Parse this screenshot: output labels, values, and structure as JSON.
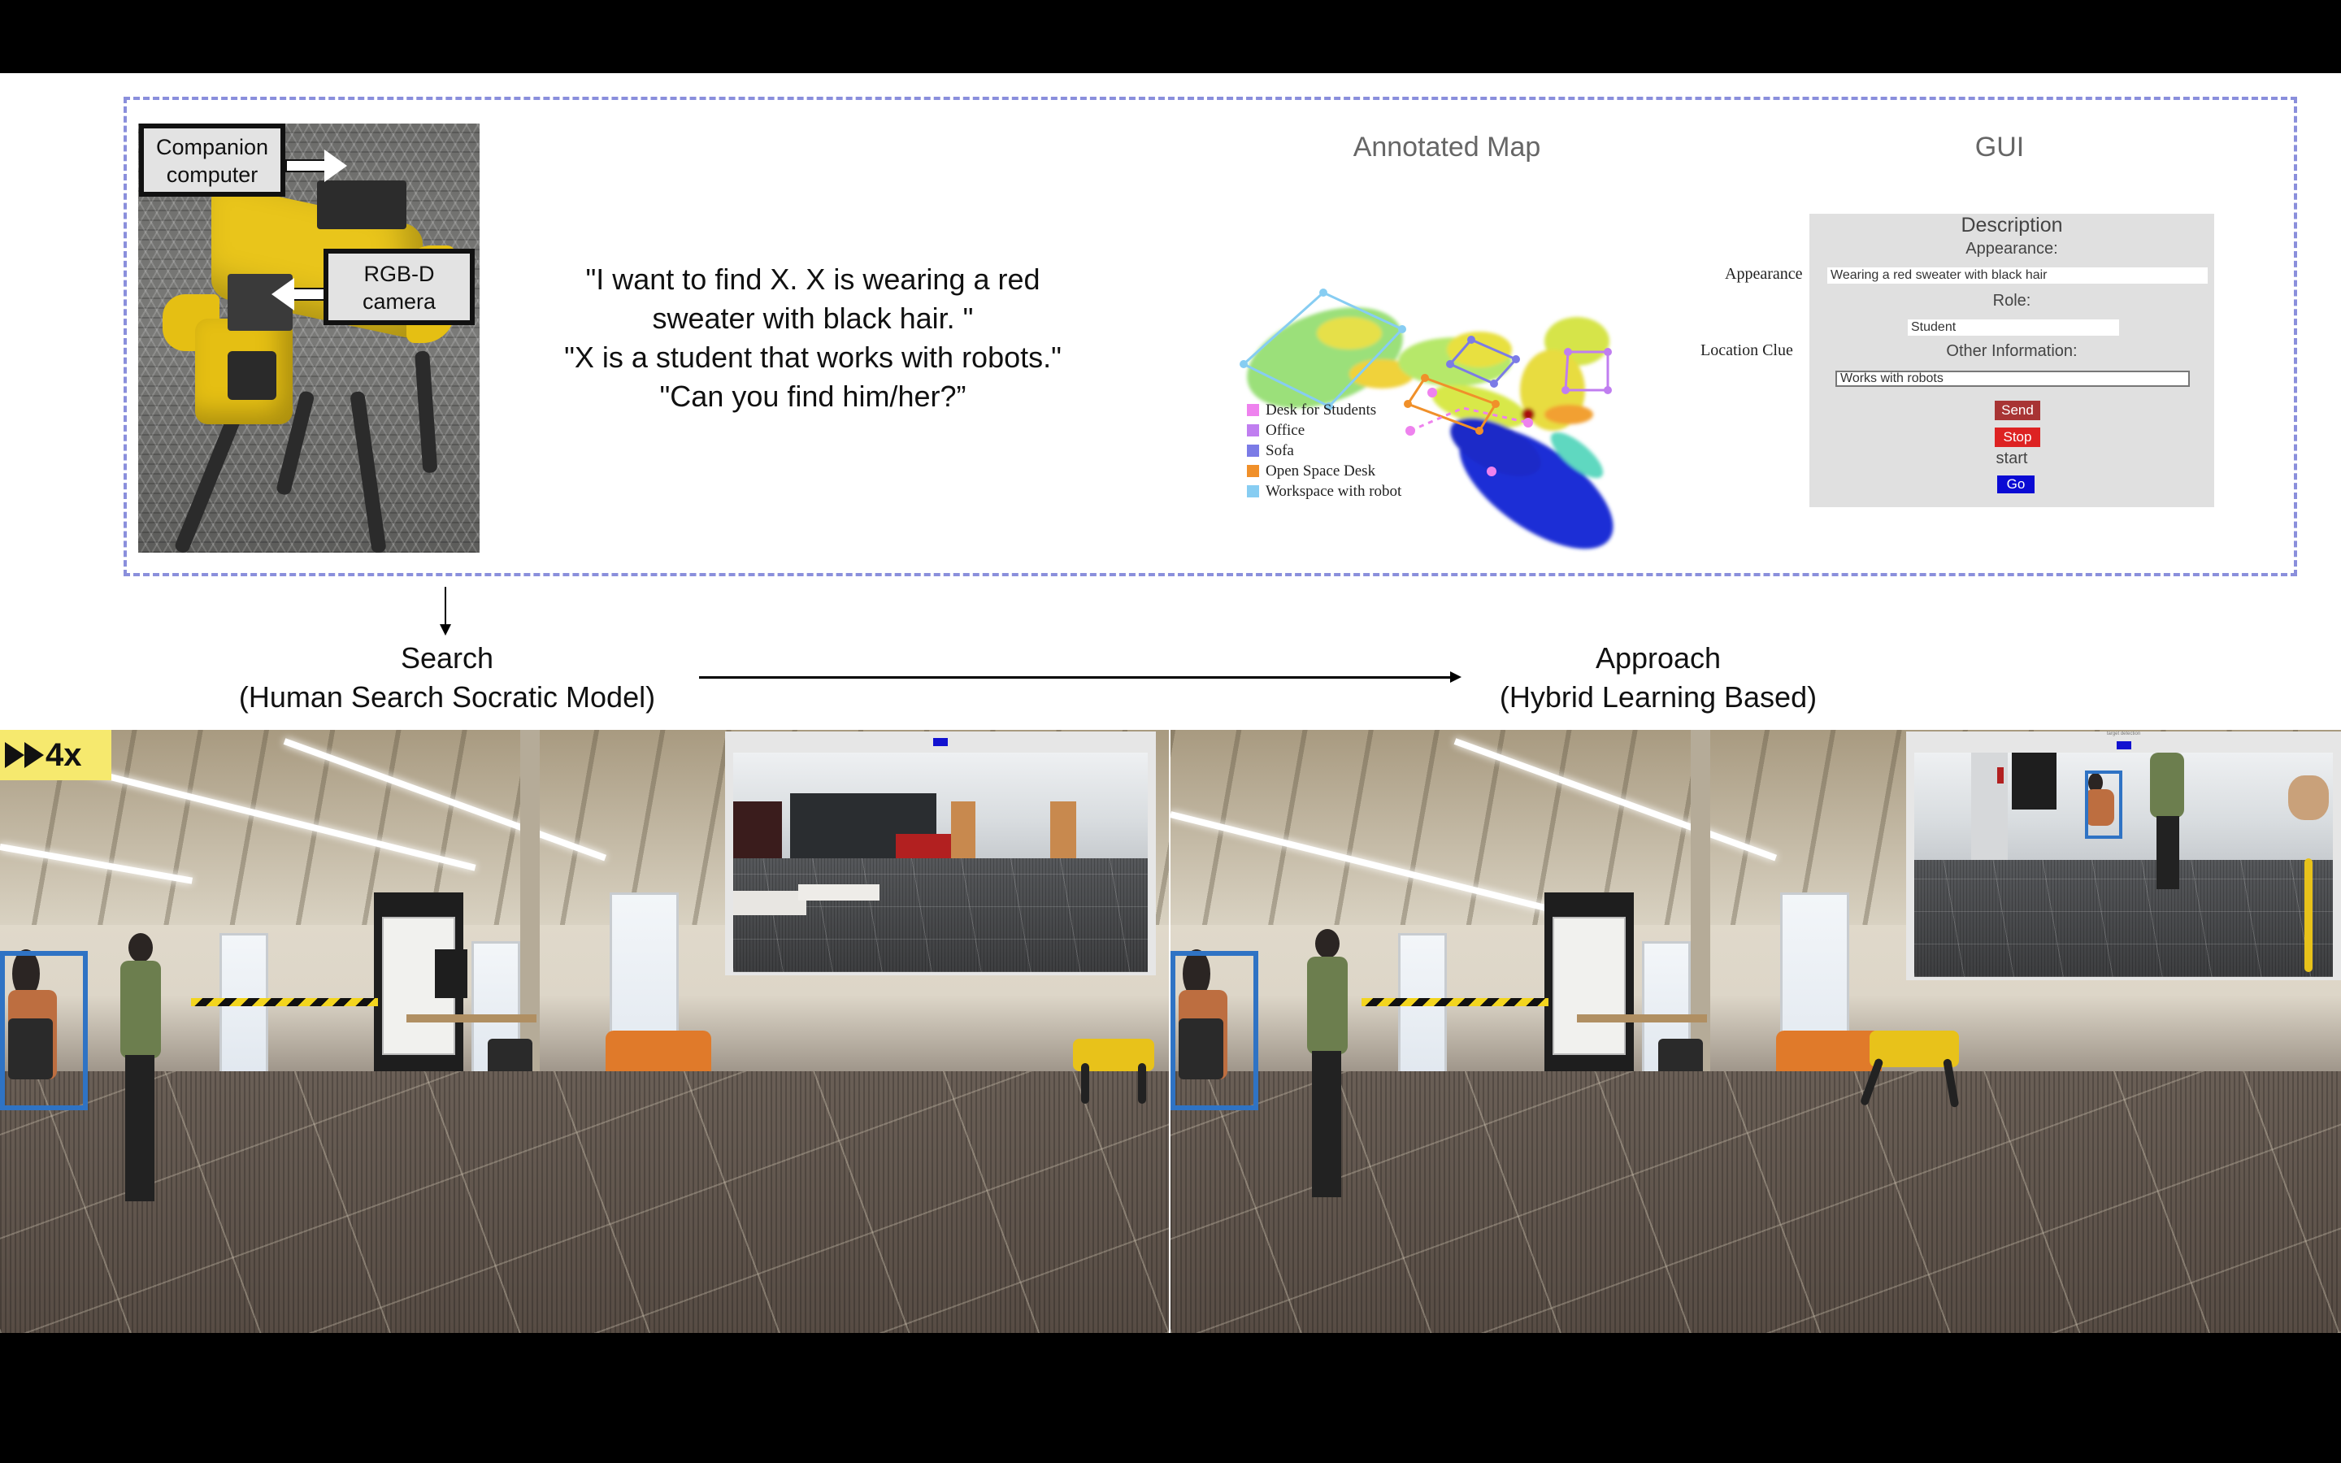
{
  "robot_photo": {
    "companion_label": "Companion computer",
    "companion_lines": [
      "Companion",
      "computer"
    ],
    "camera_lines": [
      "RGB-D",
      "camera"
    ]
  },
  "request_quote": {
    "lines": [
      "\"I want to find X. X is wearing a red",
      "sweater with black hair. \"",
      "\"X is a student that works with robots.\"",
      "\"Can you find him/her?”"
    ]
  },
  "annotated_map": {
    "title": "Annotated Map",
    "legend": [
      {
        "label": "Desk for Students",
        "color": "#ee82ee"
      },
      {
        "label": "Office",
        "color": "#c07ef0"
      },
      {
        "label": "Sofa",
        "color": "#7b7be6"
      },
      {
        "label": "Open Space Desk",
        "color": "#f0902a"
      },
      {
        "label": "Workspace with robot",
        "color": "#87cdf2"
      }
    ]
  },
  "gui": {
    "title": "GUI",
    "side_labels": {
      "appearance": "Appearance",
      "location_clue": "Location Clue"
    },
    "heading": "Description",
    "appearance_label": "Appearance:",
    "appearance_value": "Wearing a red sweater with black hair",
    "role_label": "Role:",
    "role_value": "Student",
    "other_label": "Other Information:",
    "other_value": "Works with robots",
    "send_button": "Send",
    "stop_button": "Stop",
    "start_label": "start",
    "go_button": "Go",
    "colors": {
      "send": "#a83434",
      "stop": "#dd2222",
      "go": "#0a0ad4",
      "panel": "#e0e0e0"
    }
  },
  "flow": {
    "search": {
      "title": "Search",
      "subtitle": "(Human Search Socratic Model)"
    },
    "approach": {
      "title": "Approach",
      "subtitle": "(Hybrid Learning Based)"
    }
  },
  "video": {
    "speed_label": "4x",
    "inset_right_caption": "target detection"
  },
  "colors": {
    "panel_border": "#8a8fdc",
    "detection_box": "#2f73c4",
    "speed_badge": "#f6e96e"
  }
}
